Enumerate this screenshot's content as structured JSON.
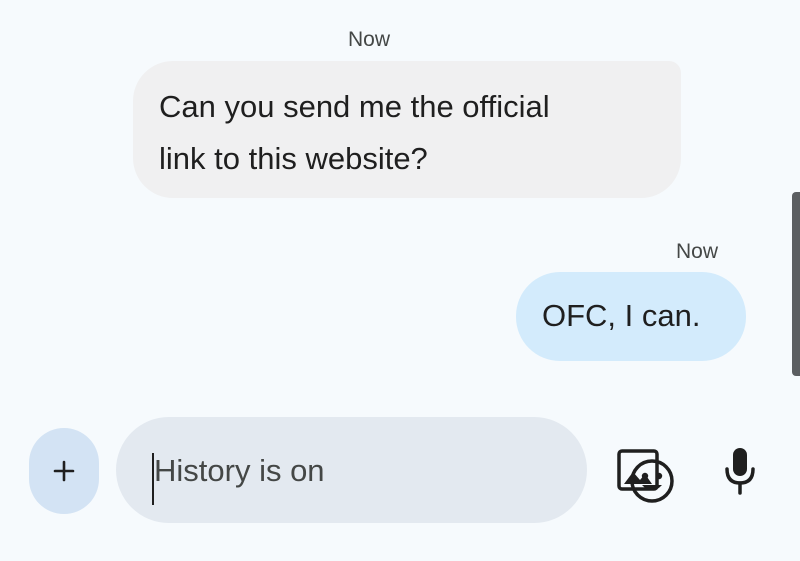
{
  "messages": [
    {
      "direction": "incoming",
      "timestamp": "Now",
      "lines": [
        "Can you send me the official",
        "link to this website?"
      ]
    },
    {
      "direction": "outgoing",
      "timestamp": "Now",
      "lines": [
        "OFC, I can."
      ]
    }
  ],
  "composer": {
    "attach_icon": "plus-icon",
    "placeholder": "History is on",
    "value": "",
    "emoji_icon": "emoji-icon",
    "gallery_icon": "image-icon",
    "voice_icon": "mic-icon"
  },
  "colors": {
    "background": "#f6fafd",
    "incoming_bubble": "#f0f0f1",
    "outgoing_bubble": "#d3ebfc",
    "input_pill": "#e3e9f0",
    "attach_button": "#d3e3f4",
    "text": "#1f1f1f",
    "secondary_text": "#444746"
  }
}
